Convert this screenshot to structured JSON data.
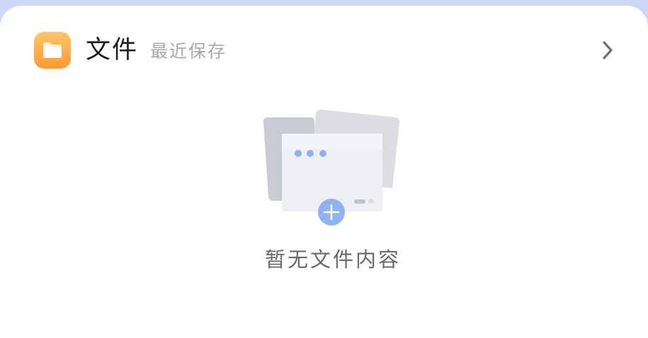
{
  "widget": {
    "title": "文件",
    "subtitle": "最近保存",
    "app_icon": "folder-icon",
    "more_icon": "chevron-right-icon"
  },
  "empty_state": {
    "illustration": "empty-folder-illustration",
    "message": "暂无文件内容"
  },
  "colors": {
    "background": "#ccd8f6",
    "card": "#ffffff",
    "icon_gradient_top": "#ffc56a",
    "icon_gradient_bottom": "#ff9a2e",
    "accent_blue": "#8fb2f5"
  }
}
